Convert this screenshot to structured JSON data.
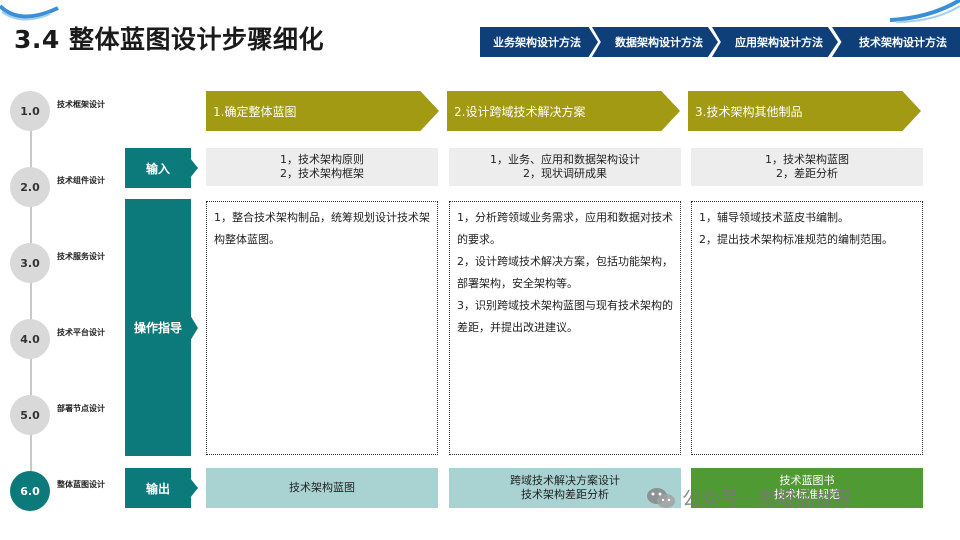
{
  "title": "3.4 整体蓝图设计步骤细化",
  "nav": [
    "业务架构设计方法",
    "数据架构设计方法",
    "应用架构设计方法",
    "技术架构设计方法"
  ],
  "colors": {
    "navy": "#0e3f78",
    "teal": "#0c7a7a",
    "olive": "#a19a12",
    "green": "#4f9a32",
    "light_teal": "#a9d3d3"
  },
  "steps": [
    {
      "num": "1.0",
      "label": "技术框架设计"
    },
    {
      "num": "2.0",
      "label": "技术组件设计"
    },
    {
      "num": "3.0",
      "label": "技术服务设计"
    },
    {
      "num": "4.0",
      "label": "技术平台设计"
    },
    {
      "num": "5.0",
      "label": "部署节点设计"
    },
    {
      "num": "6.0",
      "label": "整体蓝图设计"
    }
  ],
  "columns": [
    "1.确定整体蓝图",
    "2.设计跨域技术解决方案",
    "3.技术架构其他制品"
  ],
  "row_labels": {
    "input": "输入",
    "guide": "操作指导",
    "output": "输出"
  },
  "inputs": [
    [
      "1，技术架构原则",
      "2，技术架构框架"
    ],
    [
      "1，业务、应用和数据架构设计",
      "2，现状调研成果"
    ],
    [
      "1，技术架构蓝图",
      "2，差距分析"
    ]
  ],
  "guides": [
    [
      "1，整合技术架构制品，统筹规划设计技术架构整体蓝图。"
    ],
    [
      "1，分析跨领域业务需求，应用和数据对技术的要求。",
      "2，设计跨域技术解决方案，包括功能架构，部署架构，安全架构等。",
      "3，识别跨域技术架构蓝图与现有技术架构的差距，并提出改进建议。"
    ],
    [
      "1，辅导领域技术蓝皮书编制。",
      "2，提出技术架构标准规范的编制范围。"
    ]
  ],
  "outputs": [
    [
      "技术架构蓝图"
    ],
    [
      "跨域技术解决方案设计",
      "技术架构差距分析"
    ],
    [
      "技术蓝图书",
      "技术标准规范"
    ]
  ],
  "watermark": "公众号 · 肉眼品世界"
}
